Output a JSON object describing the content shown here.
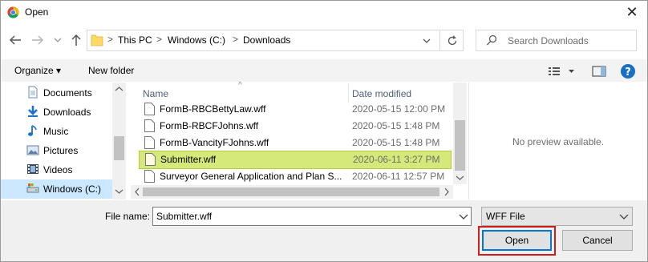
{
  "window": {
    "title": "Open",
    "app_icon": "chrome-icon",
    "close_glyph": "✕"
  },
  "nav": {
    "back_icon": "back-arrow-icon",
    "forward_icon": "forward-arrow-icon",
    "recent_icon": "chevron-down-icon",
    "up_icon": "up-arrow-icon"
  },
  "address": {
    "crumbs": [
      "This PC",
      "Windows (C:)",
      "Downloads"
    ],
    "separator": ">"
  },
  "search": {
    "placeholder": "Search Downloads"
  },
  "toolbar": {
    "organize_label": "Organize ▾",
    "new_folder_label": "New folder",
    "help_label": "?"
  },
  "sidebar": {
    "items": [
      {
        "label": "Documents",
        "icon": "documents-icon"
      },
      {
        "label": "Downloads",
        "icon": "downloads-icon"
      },
      {
        "label": "Music",
        "icon": "music-icon"
      },
      {
        "label": "Pictures",
        "icon": "pictures-icon"
      },
      {
        "label": "Videos",
        "icon": "videos-icon"
      },
      {
        "label": "Windows (C:)",
        "icon": "drive-icon",
        "selected": true
      }
    ]
  },
  "file_list": {
    "columns": [
      "Name",
      "Date modified"
    ],
    "rows": [
      {
        "name": "FormB-RBCBettyLaw.wff",
        "date": "2020-05-15 12:00 PM"
      },
      {
        "name": "FormB-RBCFJohns.wff",
        "date": "2020-05-15 1:48 PM"
      },
      {
        "name": "FormB-VancityFJohns.wff",
        "date": "2020-05-15 1:48 PM"
      },
      {
        "name": "Submitter.wff",
        "date": "2020-06-11 3:27 PM",
        "selected": true
      },
      {
        "name": "Surveyor General Application and Plan S...",
        "date": "2020-06-11 12:57 PM"
      }
    ]
  },
  "preview": {
    "text": "No preview available."
  },
  "footer": {
    "filename_label": "File name:",
    "filename_value": "Submitter.wff",
    "filetype_value": "WFF File",
    "open_label": "Open",
    "cancel_label": "Cancel",
    "highlight_color": "#d51a1a",
    "selected_row_color": "#d5e97a"
  }
}
